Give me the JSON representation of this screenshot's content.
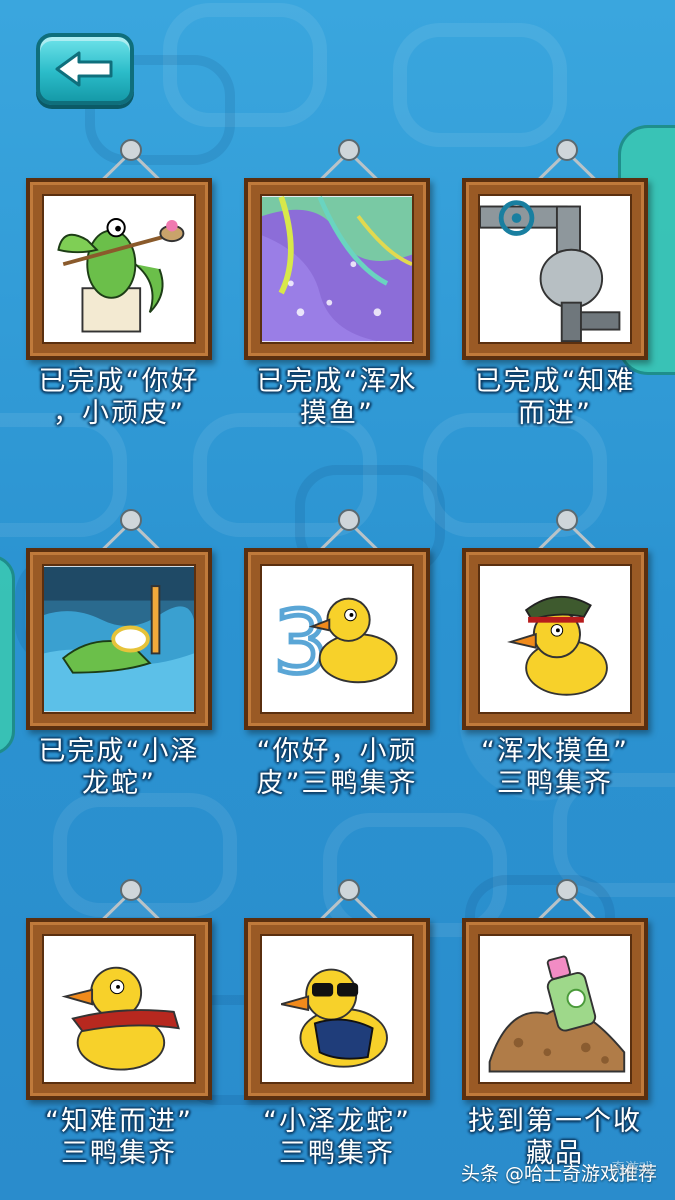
{
  "back_button": {
    "icon": "arrow-left-icon"
  },
  "items": [
    {
      "caption": "已完成“你好\n，小顽皮”",
      "art": "crocodile-bath-art"
    },
    {
      "caption": "已完成“浑水\n摸鱼”",
      "art": "purple-water-art"
    },
    {
      "caption": "已完成“知难\n而进”",
      "art": "valve-pipe-art"
    },
    {
      "caption": "已完成“小泽\n龙蛇”",
      "art": "crocodile-snorkel-art"
    },
    {
      "caption": "“你好，小顽\n皮”三鸭集齐",
      "art": "duck-three-art"
    },
    {
      "caption": "“浑水摸鱼”\n三鸭集齐",
      "art": "duck-soldier-art"
    },
    {
      "caption": "“知难而进”\n三鸭集齐",
      "art": "duck-scarf-art"
    },
    {
      "caption": "“小泽龙蛇”\n三鸭集齐",
      "art": "duck-sunglasses-art"
    },
    {
      "caption": "找到第一个收\n藏品",
      "art": "collectible-bottle-art"
    }
  ],
  "watermark": {
    "text": "头条 @哈士奇游戏推荐",
    "faded_text": "奇游戏"
  },
  "colors": {
    "background": "#2f9ad6",
    "frame": "#9a5a25",
    "back_button": "#2bbcc9"
  }
}
